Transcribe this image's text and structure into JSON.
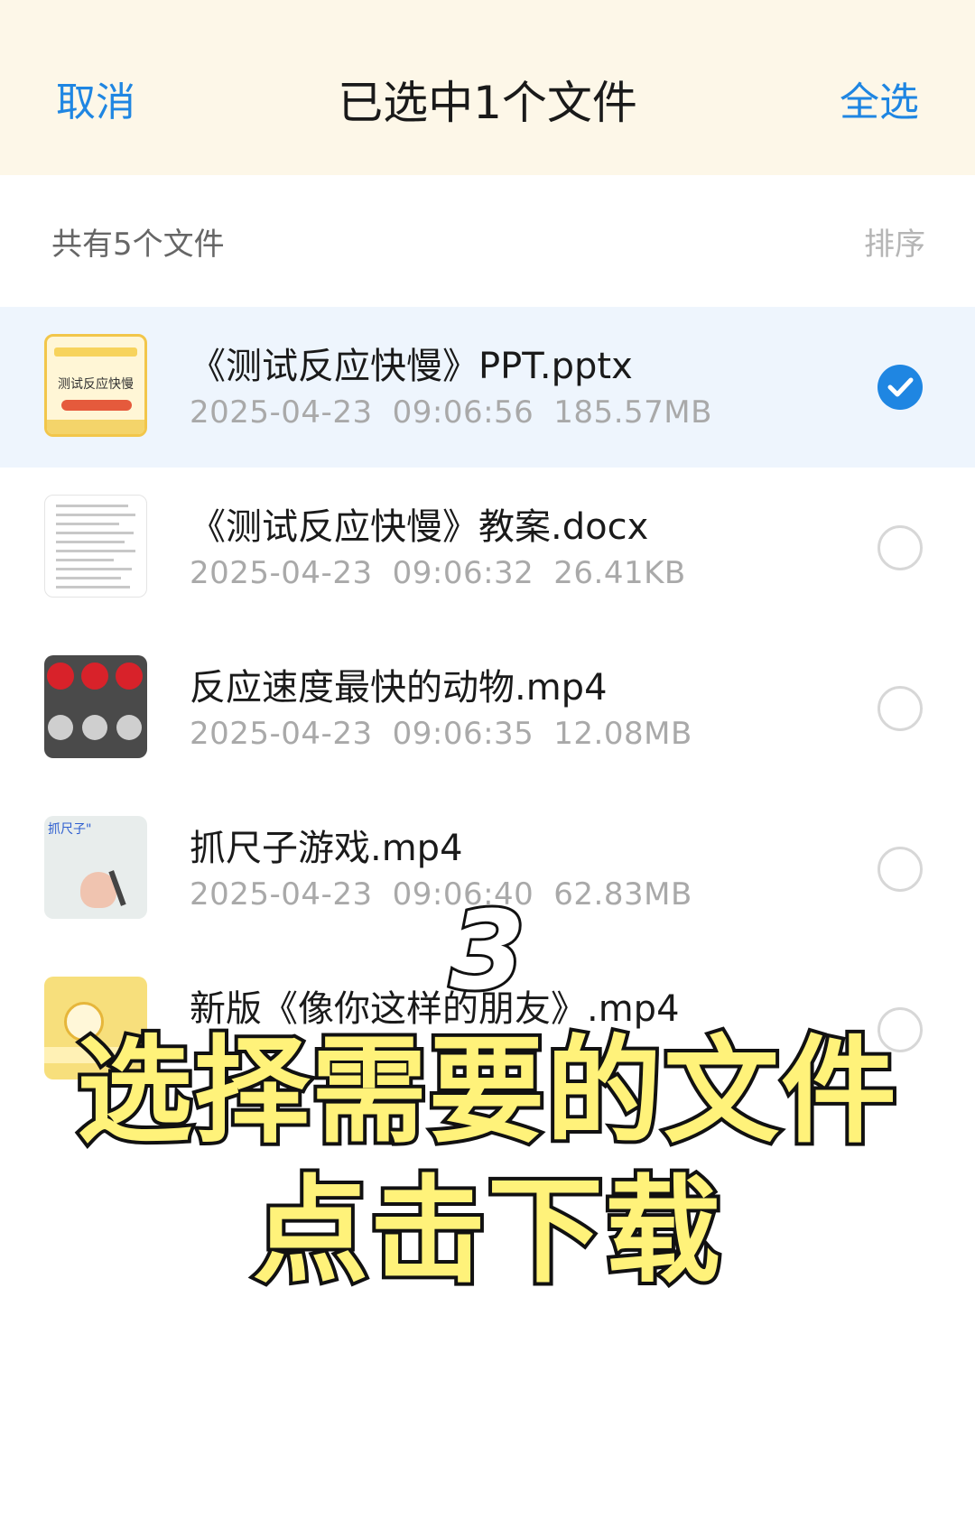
{
  "header": {
    "cancel_label": "取消",
    "title": "已选中1个文件",
    "select_all_label": "全选"
  },
  "subheader": {
    "count_label": "共有5个文件",
    "sort_label": "排序"
  },
  "files": [
    {
      "name": "《测试反应快慢》PPT.pptx",
      "date": "2025-04-23",
      "time": "09:06:56",
      "size": "185.57MB",
      "selected": true,
      "thumb_text": "测试反应快慢"
    },
    {
      "name": "《测试反应快慢》教案.docx",
      "date": "2025-04-23",
      "time": "09:06:32",
      "size": "26.41KB",
      "selected": false
    },
    {
      "name": "反应速度最快的动物.mp4",
      "date": "2025-04-23",
      "time": "09:06:35",
      "size": "12.08MB",
      "selected": false
    },
    {
      "name": "抓尺子游戏.mp4",
      "date": "2025-04-23",
      "time": "09:06:40",
      "size": "62.83MB",
      "selected": false,
      "thumb_text": "抓尺子\""
    },
    {
      "name": "新版《像你这样的朋友》.mp4",
      "date": "",
      "time": "",
      "size": "",
      "selected": false
    }
  ],
  "overlay": {
    "step_number": "3",
    "line1": "选择需要的文件",
    "line2": "点击下载"
  },
  "colors": {
    "accent": "#1f86e2",
    "header_bg": "#fdf7e8",
    "selected_row_bg": "#eef5fd",
    "overlay_text": "#fff27a"
  }
}
